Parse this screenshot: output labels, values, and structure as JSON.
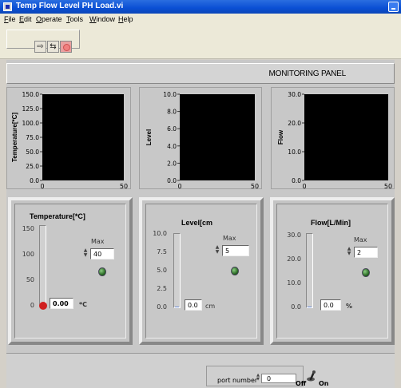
{
  "window": {
    "title": "Temp Flow Level PH Load.vi"
  },
  "menu": [
    "File",
    "Edit",
    "Operate",
    "Tools",
    "Window",
    "Help"
  ],
  "toolbar": {
    "run": "⇨",
    "run_continuous": "⇆"
  },
  "panel": {
    "title": "MONITORING PANEL"
  },
  "charts": [
    {
      "ylabel": "Temperature[*C]",
      "yticks": [
        "150.0",
        "125.0",
        "100.0",
        "75.0",
        "50.0",
        "25.0",
        "0.0"
      ],
      "xticks": [
        "0",
        "50"
      ]
    },
    {
      "ylabel": "Level",
      "yticks": [
        "10.0",
        "8.0",
        "6.0",
        "4.0",
        "2.0",
        "0.0"
      ],
      "xticks": [
        "0",
        "50"
      ]
    },
    {
      "ylabel": "Flow",
      "yticks": [
        "30.0",
        "20.0",
        "10.0",
        "0.0"
      ],
      "xticks": [
        "0",
        "50"
      ]
    }
  ],
  "gauges": [
    {
      "title": "Temperature[*C]",
      "ticks": [
        "150",
        "100",
        "50",
        "0"
      ],
      "value": "0.00",
      "unit": "*C",
      "max_label": "Max",
      "max_value": "40"
    },
    {
      "title": "Level[cm",
      "ticks": [
        "10.0",
        "7.5",
        "5.0",
        "2.5",
        "0.0"
      ],
      "value": "0.0",
      "unit": "cm",
      "max_label": "Max",
      "max_value": "5"
    },
    {
      "title": "Flow[L/Min]",
      "ticks": [
        "30.0",
        "20.0",
        "10.0",
        "0.0"
      ],
      "value": "0.0",
      "unit": "%",
      "max_label": "Max",
      "max_value": "2"
    }
  ],
  "footer": {
    "port_label": "port number",
    "port_value": "0",
    "switch_off": "Off",
    "switch_on": "On"
  },
  "colors": {
    "titlebar": "#0a4fd4",
    "plot_bg": "#000000",
    "led": "#2f7a2a",
    "bulb": "#d02020"
  }
}
